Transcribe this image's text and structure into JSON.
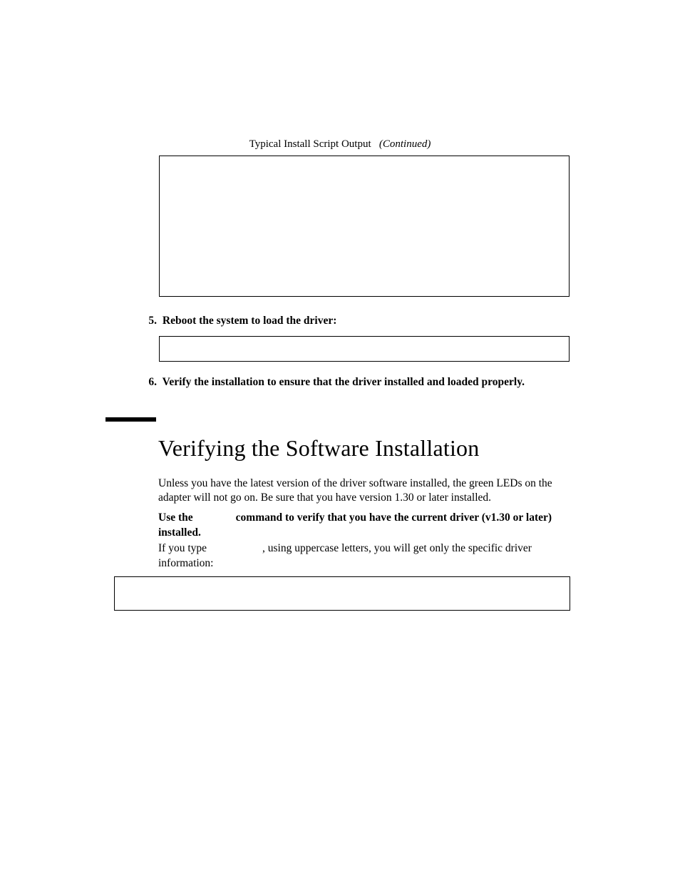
{
  "caption": {
    "title": "Typical Install Script Output",
    "suffix": "(Continued)"
  },
  "steps": {
    "five": {
      "number": "5.",
      "text": "Reboot the system to load the driver:"
    },
    "six": {
      "number": "6.",
      "text": "Verify the installation to ensure that the driver installed and loaded properly."
    }
  },
  "heading": "Verifying the Software Installation",
  "paragraphs": {
    "p1": "Unless you have the latest version of the driver software installed, the green LEDs on the adapter will not go on. Be sure that you have version 1.30 or later installed.",
    "p2a": "Use the",
    "p2b": "command to verify that you have the current driver (v1.30 or later) installed.",
    "p3a": "If you type",
    "p3b": ", using uppercase letters, you will get only the specific driver information:"
  }
}
